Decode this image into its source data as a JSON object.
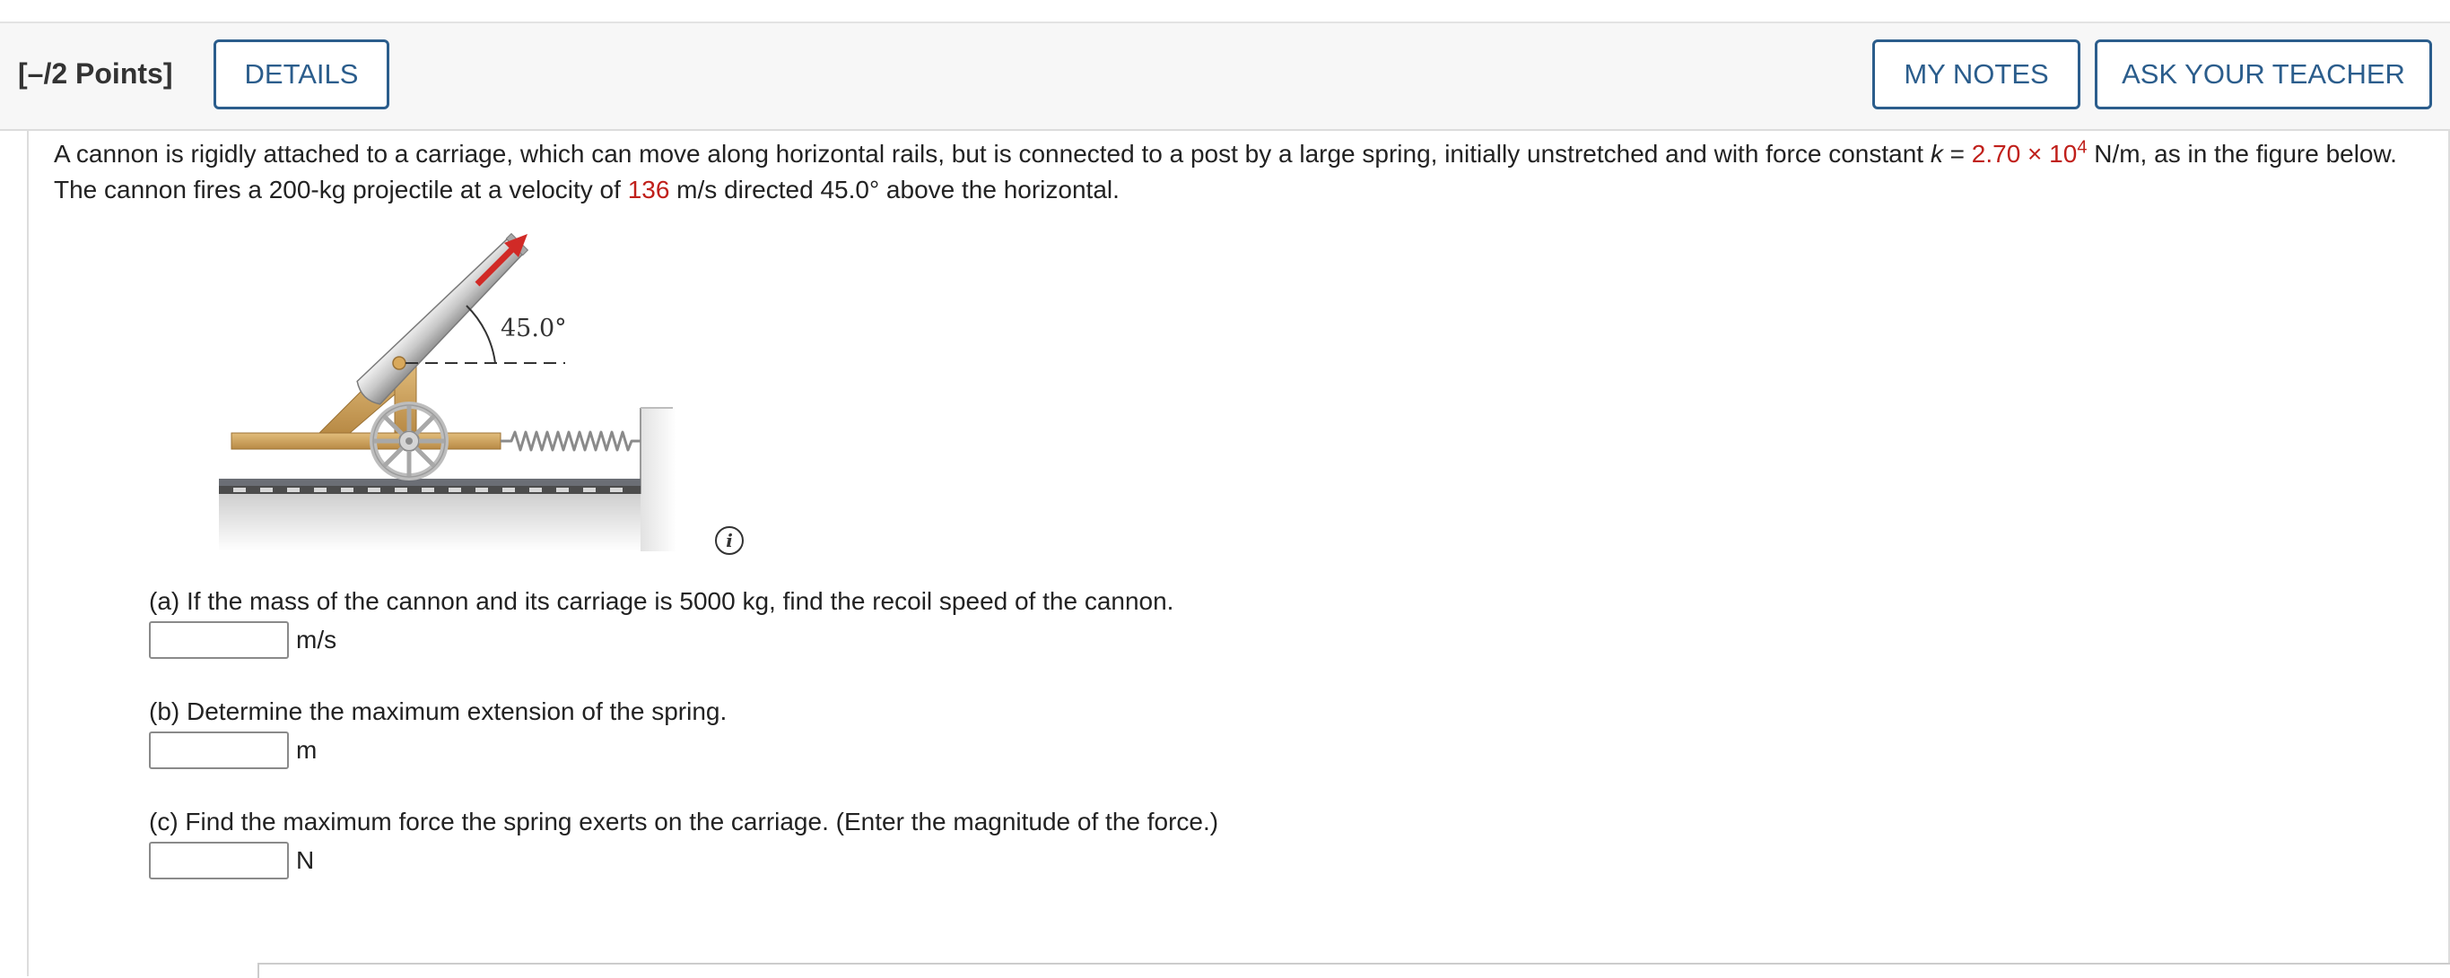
{
  "header": {
    "points": "[–/2 Points]",
    "details_label": "DETAILS",
    "my_notes_label": "MY NOTES",
    "ask_teacher_label": "ASK YOUR TEACHER"
  },
  "question": {
    "p1": "A cannon is rigidly attached to a carriage, which can move along horizontal rails, but is connected to a post by a large spring, initially unstretched and with force constant ",
    "k_var": "k",
    "eq": " = ",
    "k_value": "2.70 × 10",
    "k_exp": "4",
    "p2": " N/m, as in the figure below. The cannon fires a 200-kg projectile at a velocity of ",
    "velocity": "136",
    "p3": " m/s directed 45.0° above the horizontal."
  },
  "figure": {
    "angle_label": "45.0°",
    "info_glyph": "i"
  },
  "parts": [
    {
      "prompt": "(a) If the mass of the cannon and its carriage is 5000 kg, find the recoil speed of the cannon.",
      "value": "",
      "unit": "m/s"
    },
    {
      "prompt": "(b) Determine the maximum extension of the spring.",
      "value": "",
      "unit": "m"
    },
    {
      "prompt": "(c) Find the maximum force the spring exerts on the carriage. (Enter the magnitude of the force.)",
      "value": "",
      "unit": "N"
    }
  ],
  "colors": {
    "accent": "#2b5d8c",
    "highlight_red": "#c0201b"
  }
}
